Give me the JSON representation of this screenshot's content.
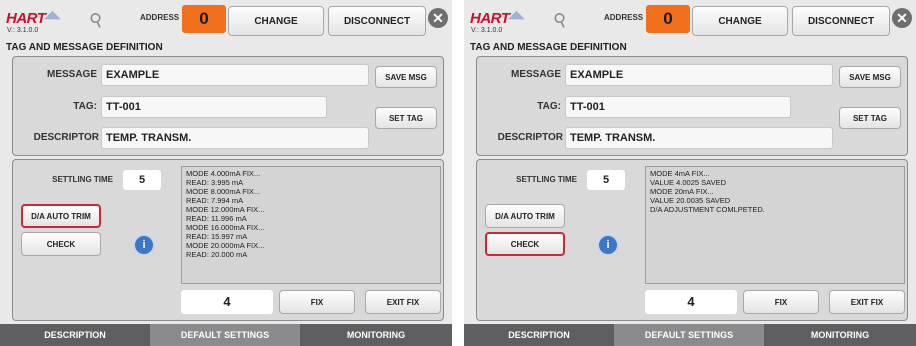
{
  "panels": [
    {
      "header": {
        "brand": "HART",
        "version": "V.: 3.1.0.0",
        "address_label": "ADDRESS",
        "address_value": "0",
        "change_label": "CHANGE",
        "disconnect_label": "DISCONNECT",
        "close_glyph": "✕"
      },
      "section_title": "TAG AND MESSAGE DEFINITION",
      "message": {
        "label": "MESSAGE",
        "value": "EXAMPLE",
        "save_label": "SAVE MSG"
      },
      "tag": {
        "label": "TAG:",
        "value": "TT-001",
        "set_label": "SET TAG"
      },
      "descriptor": {
        "label": "DESCRIPTOR",
        "value": "TEMP. TRANSM."
      },
      "settling": {
        "label": "SETTLING TIME",
        "value": "5"
      },
      "trim_label": "D/A AUTO TRIM",
      "check_label": "CHECK",
      "highlight": "trim",
      "log": [
        "MODE 4.000mA FIX...",
        "READ: 3.995 mA",
        "MODE 8.000mA FIX...",
        "READ: 7.994 mA",
        "MODE 12.000mA FIX...",
        "READ: 11.996 mA",
        "MODE 16.000mA FIX...",
        "READ: 15.997 mA",
        "MODE 20.000mA FIX...",
        "READ: 20.000 mA"
      ],
      "fix_value": "4",
      "fix_label": "FIX",
      "exit_fix_label": "EXIT FIX",
      "tabs": [
        "DESCRIPTION",
        "DEFAULT SETTINGS",
        "MONITORING"
      ],
      "active_tab": 1
    },
    {
      "header": {
        "brand": "HART",
        "version": "V.: 3.1.0.0",
        "address_label": "ADDRESS",
        "address_value": "0",
        "change_label": "CHANGE",
        "disconnect_label": "DISCONNECT",
        "close_glyph": "✕"
      },
      "section_title": "TAG AND MESSAGE DEFINITION",
      "message": {
        "label": "MESSAGE",
        "value": "EXAMPLE",
        "save_label": "SAVE MSG"
      },
      "tag": {
        "label": "TAG:",
        "value": "TT-001",
        "set_label": "SET TAG"
      },
      "descriptor": {
        "label": "DESCRIPTOR",
        "value": "TEMP. TRANSM."
      },
      "settling": {
        "label": "SETTLING TIME",
        "value": "5"
      },
      "trim_label": "D/A AUTO TRIM",
      "check_label": "CHECK",
      "highlight": "check",
      "log": [
        "MODE 4mA FIX...",
        "VALUE 4.0025 SAVED",
        "MODE 20mA FIX...",
        "VALUE 20.0035 SAVED",
        "D/A ADJUSTMENT COMLPETED."
      ],
      "fix_value": "4",
      "fix_label": "FIX",
      "exit_fix_label": "EXIT FIX",
      "tabs": [
        "DESCRIPTION",
        "DEFAULT SETTINGS",
        "MONITORING"
      ],
      "active_tab": 1
    }
  ],
  "colors": {
    "accent_orange": "#f0701c",
    "highlight_red": "#c8283a",
    "tab_bar": "#5f5f61",
    "brand_red": "#c8102e"
  },
  "icons": {
    "close": "close-icon",
    "info": "info-icon",
    "device": "device-icon"
  }
}
